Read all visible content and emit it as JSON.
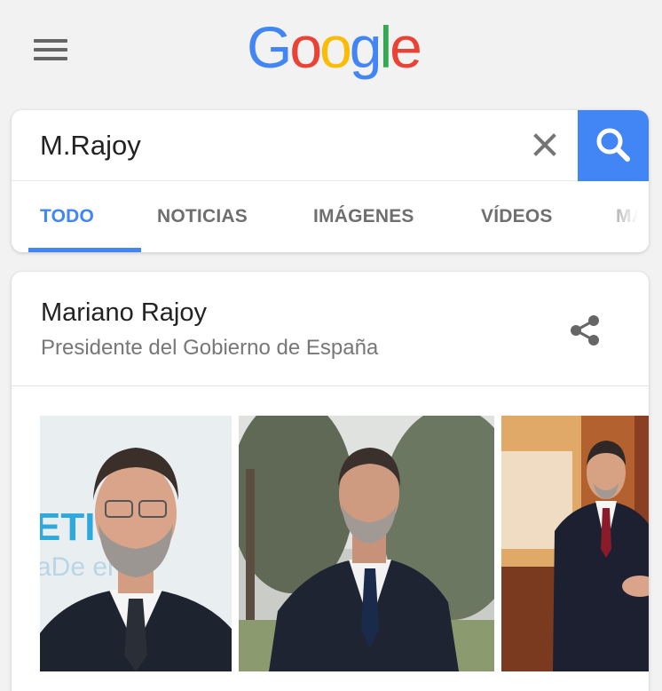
{
  "header": {
    "menu_icon": "hamburger-menu-icon",
    "logo": {
      "letters": [
        "G",
        "o",
        "o",
        "g",
        "l",
        "e"
      ],
      "colors": [
        "#4285f4",
        "#ea4335",
        "#fbbc05",
        "#4285f4",
        "#34a853",
        "#ea4335"
      ]
    }
  },
  "search": {
    "query": "M.Rajoy",
    "clear_icon": "close-icon",
    "search_icon": "search-icon",
    "accent": "#4285f4"
  },
  "tabs": [
    {
      "label": "TODO",
      "active": true
    },
    {
      "label": "NOTICIAS",
      "active": false
    },
    {
      "label": "IMÁGENES",
      "active": false
    },
    {
      "label": "VÍDEOS",
      "active": false
    },
    {
      "label": "MAPS",
      "active": false
    }
  ],
  "knowledge_panel": {
    "title": "Mariano Rajoy",
    "subtitle": "Presidente del Gobierno de España",
    "share_icon": "share-icon",
    "images": [
      {
        "alt": "Mariano Rajoy portrait"
      },
      {
        "alt": "Mariano Rajoy outdoors"
      },
      {
        "alt": "Mariano Rajoy handshake"
      }
    ]
  }
}
